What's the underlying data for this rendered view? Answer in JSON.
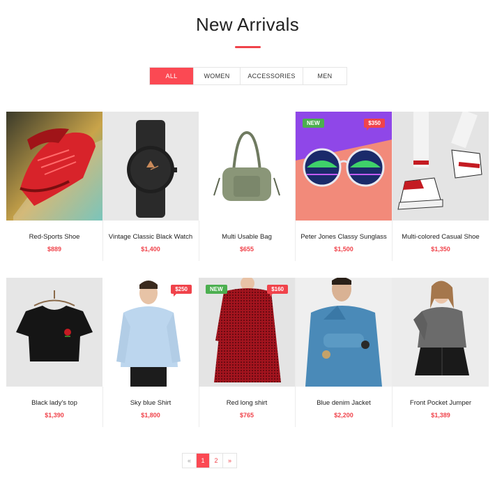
{
  "section": {
    "title": "New Arrivals"
  },
  "filters": [
    "ALL",
    "WOMEN",
    "ACCESSORIES",
    "MEN"
  ],
  "active_filter": "ALL",
  "products": [
    {
      "name": "Red-Sports Shoe",
      "price": "$889",
      "new": "",
      "badge_price": ""
    },
    {
      "name": "Vintage Classic Black Watch",
      "price": "$1,400",
      "new": "",
      "badge_price": ""
    },
    {
      "name": "Multi Usable Bag",
      "price": "$655",
      "new": "",
      "badge_price": ""
    },
    {
      "name": "Peter Jones Classy Sunglass",
      "price": "$1,500",
      "new": "NEW",
      "badge_price": "$350"
    },
    {
      "name": "Multi-colored Casual Shoe",
      "price": "$1,350",
      "new": "",
      "badge_price": ""
    },
    {
      "name": "Black lady's top",
      "price": "$1,390",
      "new": "",
      "badge_price": ""
    },
    {
      "name": "Sky blue Shirt",
      "price": "$1,800",
      "new": "",
      "badge_price": "$250"
    },
    {
      "name": "Red long shirt",
      "price": "$765",
      "new": "NEW",
      "badge_price": "$160"
    },
    {
      "name": "Blue denim Jacket",
      "price": "$2,200",
      "new": "",
      "badge_price": ""
    },
    {
      "name": "Front Pocket Jumper",
      "price": "$1,389",
      "new": "",
      "badge_price": ""
    }
  ],
  "pagination": {
    "prev": "«",
    "pages": [
      "1",
      "2"
    ],
    "next": "»",
    "current": "1"
  },
  "colors": {
    "accent": "#fb4953",
    "price": "#f0434b",
    "new_badge": "#4caf50"
  }
}
